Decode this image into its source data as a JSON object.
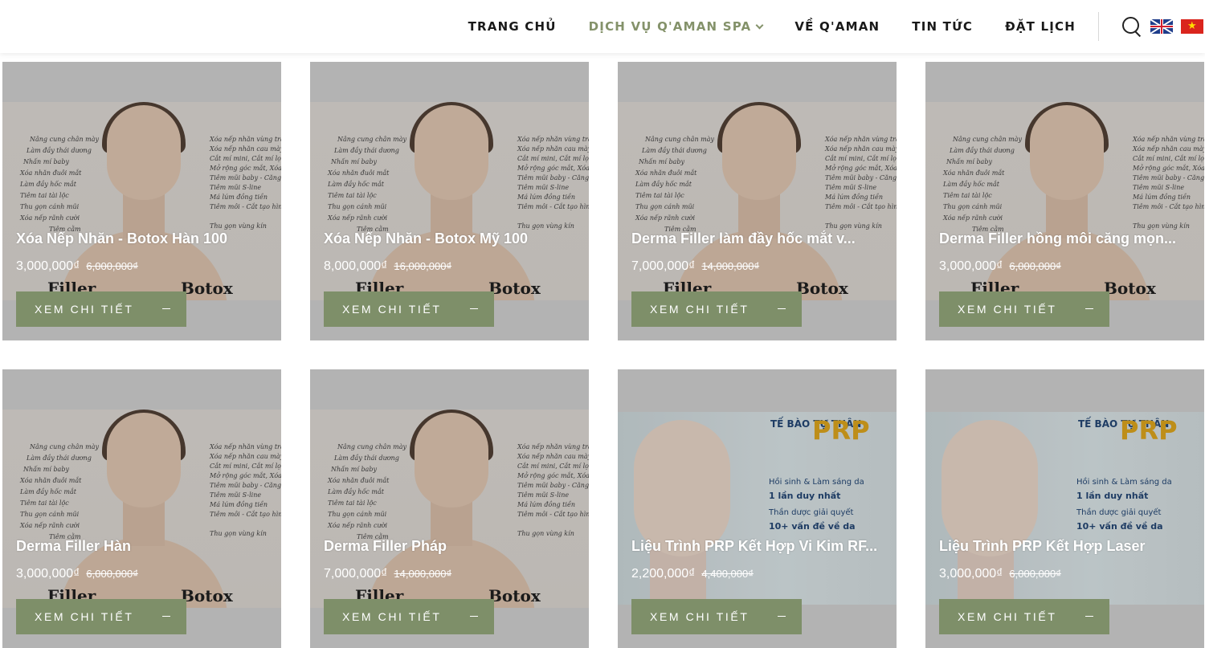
{
  "nav": {
    "items": [
      {
        "label": "TRANG CHỦ",
        "active": false
      },
      {
        "label": "DỊCH VỤ Q'AMAN SPA",
        "active": true
      },
      {
        "label": "VỀ Q'AMAN",
        "active": false
      },
      {
        "label": "TIN TỨC",
        "active": false
      },
      {
        "label": "ĐẶT LỊCH",
        "active": false
      }
    ],
    "icons": [
      "search-icon",
      "flag-uk-icon",
      "flag-vn-icon"
    ],
    "accent_color": "#84926a"
  },
  "products": [
    {
      "title": "Xóa Nếp Nhăn - Botox Hàn 100",
      "price": "3,000,000₫",
      "old_price": "6,000,000₫",
      "button": "XEM CHI TIẾT",
      "image": "filler-botox"
    },
    {
      "title": "Xóa Nếp Nhăn - Botox Mỹ 100",
      "price": "8,000,000₫",
      "old_price": "16,000,000₫",
      "button": "XEM CHI TIẾT",
      "image": "filler-botox"
    },
    {
      "title": "Derma Filler làm đầy hốc mắt v...",
      "price": "7,000,000₫",
      "old_price": "14,000,000₫",
      "button": "XEM CHI TIẾT",
      "image": "filler-botox"
    },
    {
      "title": "Derma Filler hồng môi căng mọn...",
      "price": "3,000,000₫",
      "old_price": "6,000,000₫",
      "button": "XEM CHI TIẾT",
      "image": "filler-botox"
    },
    {
      "title": "Derma Filler Hàn",
      "price": "3,000,000₫",
      "old_price": "6,000,000₫",
      "button": "XEM CHI TIẾT",
      "image": "filler-botox"
    },
    {
      "title": "Derma Filler Pháp",
      "price": "7,000,000₫",
      "old_price": "14,000,000₫",
      "button": "XEM CHI TIẾT",
      "image": "filler-botox"
    },
    {
      "title": "Liệu Trình PRP Kết Hợp Vi Kim RF...",
      "price": "2,200,000₫",
      "old_price": "4,400,000₫",
      "button": "XEM CHI TIẾT",
      "image": "prp"
    },
    {
      "title": "Liệu Trình PRP Kết Hợp Laser",
      "price": "3,000,000₫",
      "old_price": "6,000,000₫",
      "button": "XEM CHI TIẾT",
      "image": "prp"
    }
  ],
  "image_labels": {
    "filler_left": [
      "Nâng cung chân mày",
      "Làm đầy thái dương",
      "Nhấn mí baby",
      "Xóa nhăn đuôi mắt",
      "Làm đầy hốc mắt",
      "Tiêm tai tài lộc",
      "Thu gọn cánh mũi",
      "Xóa nếp rãnh cười",
      "Tiêm cằm"
    ],
    "filler_right": [
      "Xóa nếp nhăn vùng trán",
      "Xóa nếp nhăn cau mày",
      "Cắt mí mini, Cắt mí lọc da dư",
      "Mở rộng góc mắt, Xóa thâm quầng mắt",
      "Tiêm mũi baby - Căng chỉ Nano",
      "Tiêm mũi S-line",
      "Má lúm đồng tiền",
      "Tiêm môi - Cắt tạo hình môi",
      "Thu gọn vùng kín"
    ],
    "filler_word": "Filler",
    "botox_word": "Botox",
    "prp_top": "TẾ BÀO TỰ THÂN",
    "prp_big": "PRP",
    "prp_l1": "Hồi sinh & Làm sáng da",
    "prp_l2": "1 lần duy nhất",
    "prp_l3": "Thần dược giải quyết",
    "prp_l4": "10+ vấn đề về da"
  }
}
